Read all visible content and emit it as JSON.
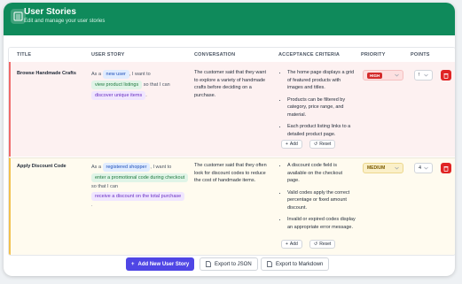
{
  "header": {
    "title": "User Stories",
    "subtitle": "Edit and manage your user stories"
  },
  "columns": [
    "TITLE",
    "USER STORY",
    "CONVERSATION",
    "ACCEPTANCE CRITERIA",
    "PRIORITY",
    "POINTS"
  ],
  "stories": [
    {
      "title": "Browse Handmade Crafts",
      "as_a": "As a",
      "role": "new user",
      "i_want": ", I want to",
      "action": "view product listings",
      "so_that": "so that I can",
      "benefit": "discover unique items",
      "end": ".",
      "conversation": "The customer said that they want to explore a variety of handmade crafts before deciding on a purchase.",
      "criteria": [
        "The home page displays a grid of featured products with images and titles.",
        "Products can be filtered by category, price range, and material.",
        "Each product listing links to a detailed product page."
      ],
      "priority": "HIGH",
      "points": "!"
    },
    {
      "title": "Apply Discount Code",
      "as_a": "As a",
      "role": "registered shopper",
      "i_want": ", I want to",
      "action": "enter a promotional code during checkout",
      "so_that": "so that I can",
      "benefit": "receive a discount on the total purchase",
      "end": ".",
      "conversation": "The customer said that they often look for discount codes to reduce the cost of handmade items.",
      "criteria": [
        "A discount code field is available on the checkout page.",
        "Valid codes apply the correct percentage or fixed amount discount.",
        "Invalid or expired codes display an appropriate error message."
      ],
      "priority": "MEDIUM",
      "points": "4"
    }
  ],
  "labels": {
    "add": "Add",
    "reset": "Reset",
    "add_story": "Add New User Story",
    "export_json": "Export to JSON",
    "export_md": "Export to Markdown"
  },
  "colors": {
    "header": "#0f8a5b",
    "high": "#d42b2b",
    "medium": "#f2c14e",
    "primary": "#4f46e5",
    "delete": "#e02424"
  }
}
